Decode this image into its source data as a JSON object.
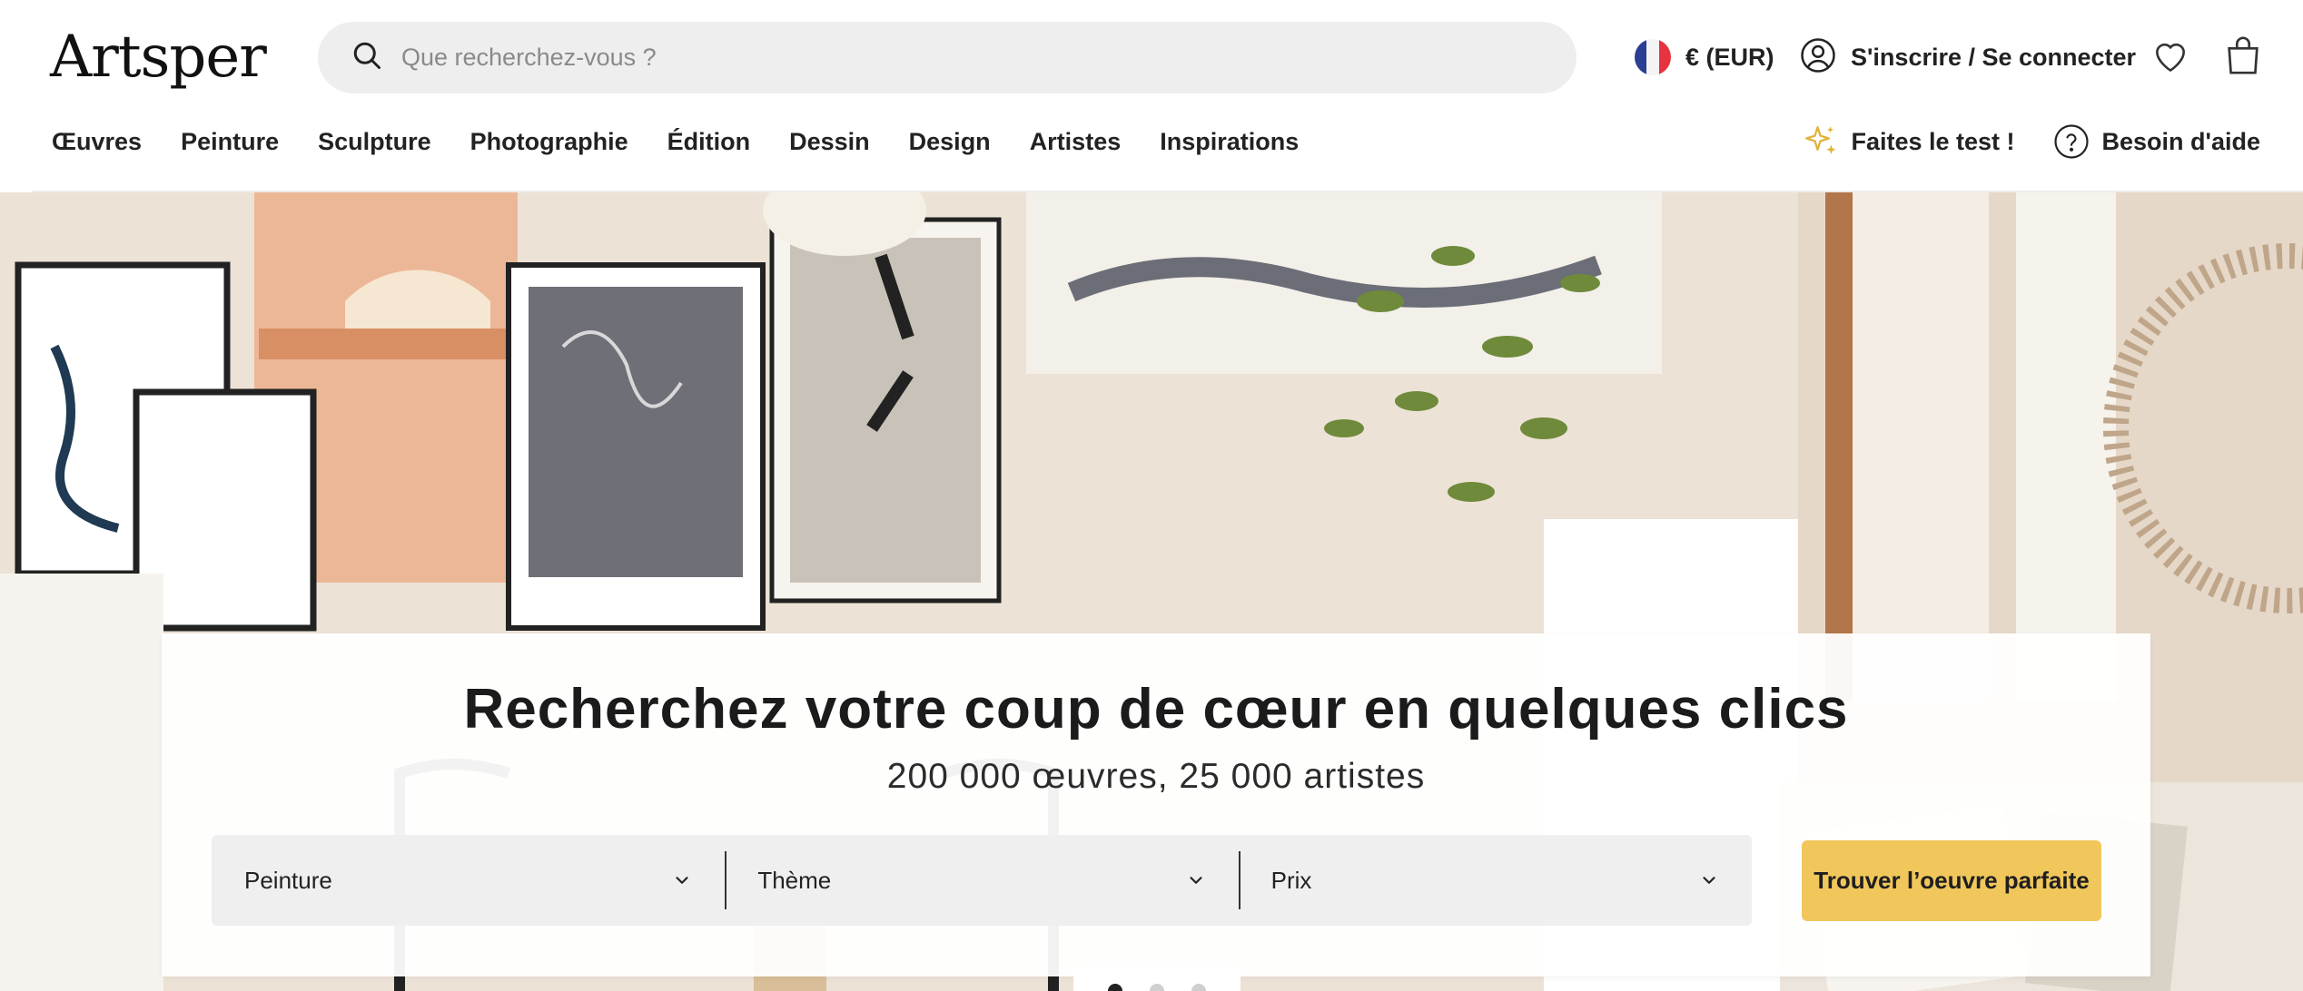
{
  "header": {
    "logo_text": "Artsper",
    "search": {
      "placeholder": "Que recherchez-vous ?",
      "value": ""
    },
    "currency_label": "€ (EUR)",
    "account_label": "S'inscrire / Se connecter",
    "icons": {
      "search": "search-icon",
      "flag": "france-flag-icon",
      "user": "user-icon",
      "wishlist": "heart-icon",
      "cart": "shopping-bag-icon"
    }
  },
  "nav": {
    "items": [
      "Œuvres",
      "Peinture",
      "Sculpture",
      "Photographie",
      "Édition",
      "Dessin",
      "Design",
      "Artistes",
      "Inspirations"
    ],
    "quiz_label": "Faites le test !",
    "help_label": "Besoin d'aide"
  },
  "hero": {
    "title": "Recherchez votre coup de cœur en quelques clics",
    "subtitle": "200 000 œuvres, 25 000 artistes",
    "filters": [
      {
        "label": "Peinture"
      },
      {
        "label": "Thème"
      },
      {
        "label": "Prix"
      }
    ],
    "cta_label": "Trouver l’oeuvre parfaite",
    "carousel": {
      "count": 3,
      "active": 1
    }
  },
  "colors": {
    "accent": "#f1c75c",
    "search_bg": "#eeeeee",
    "text": "#1f1f1f",
    "flag_blue": "#2a3e94",
    "flag_red": "#e5333f"
  }
}
